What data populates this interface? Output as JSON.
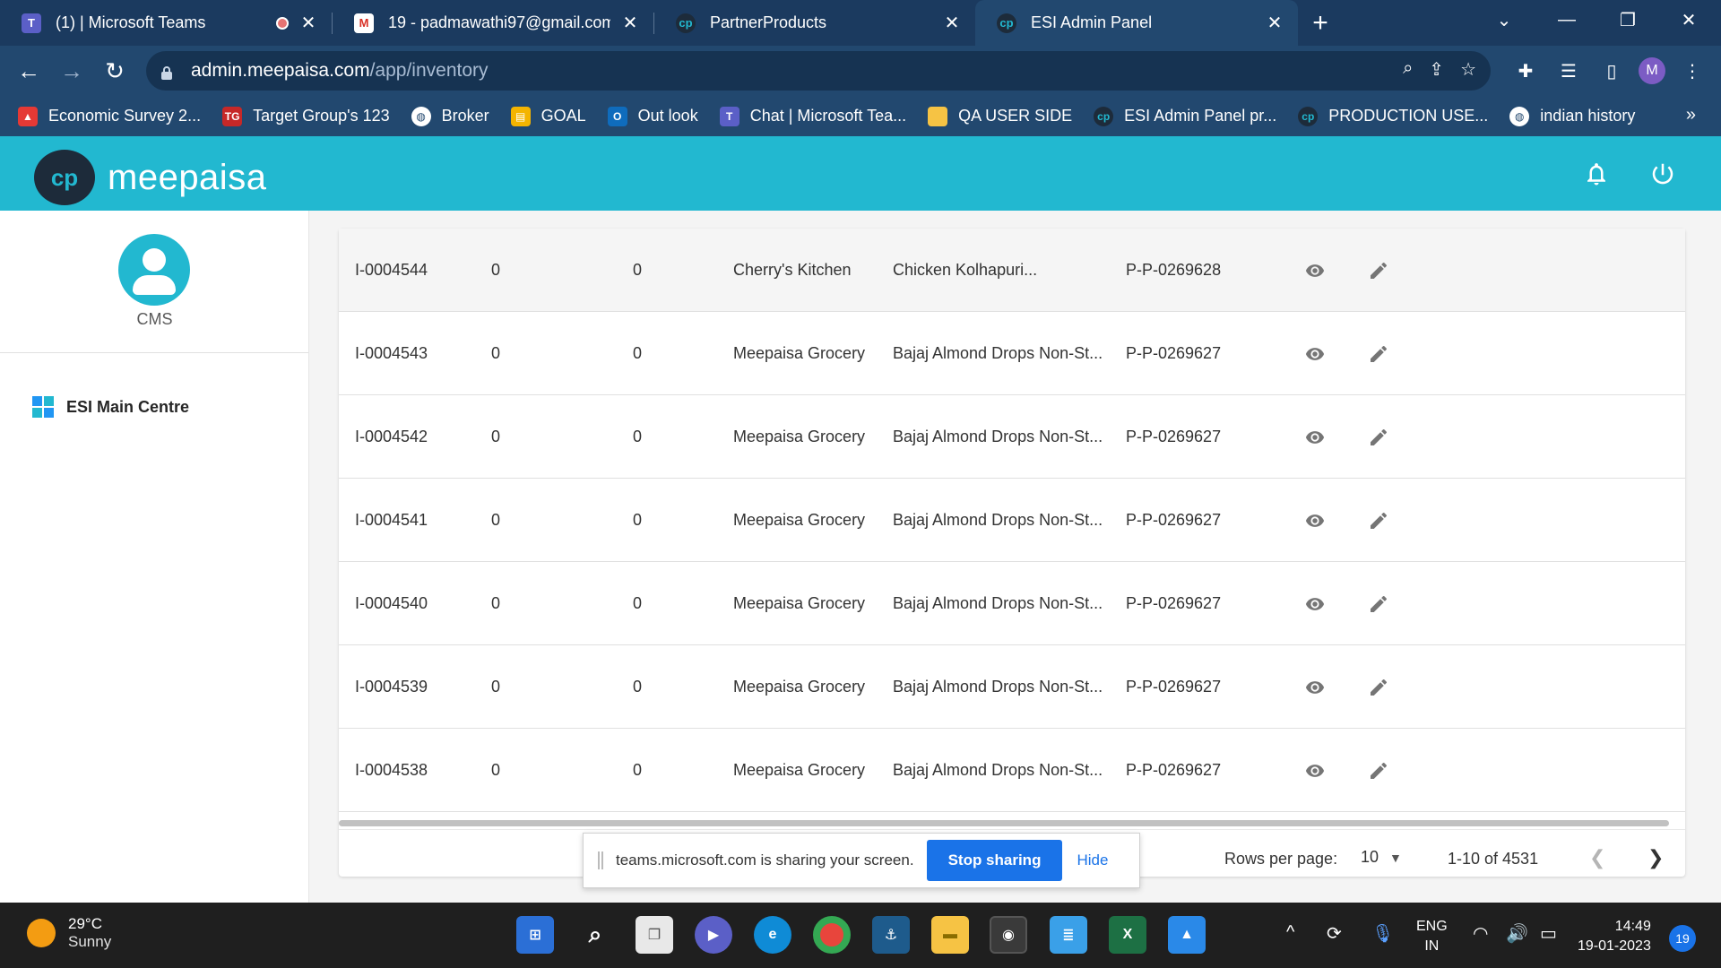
{
  "browser": {
    "tabs": [
      {
        "title": "(1) | Microsoft Teams",
        "icon": "teams-icon"
      },
      {
        "title": "19 - padmawathi97@gmail.com",
        "icon": "gmail-icon"
      },
      {
        "title": "PartnerProducts",
        "icon": "meepaisa-icon"
      },
      {
        "title": "ESI Admin Panel",
        "icon": "meepaisa-icon"
      }
    ],
    "url_host": "admin.meepaisa.com",
    "url_path": "/app/inventory",
    "profile_initial": "M",
    "bookmarks": [
      {
        "label": "Economic Survey 2...",
        "color": "#e53935"
      },
      {
        "label": "Target Group's 123",
        "color": "#c62828"
      },
      {
        "label": "Broker",
        "color": "#ffffff"
      },
      {
        "label": "GOAL",
        "color": "#f4b400"
      },
      {
        "label": "Out look",
        "color": "#0f6cbd"
      },
      {
        "label": "Chat | Microsoft Tea...",
        "color": "#5b5fc7"
      },
      {
        "label": "QA USER SIDE",
        "color": "#f6c344"
      },
      {
        "label": "ESI Admin Panel pr...",
        "color": "#1d2b3a"
      },
      {
        "label": "PRODUCTION USE...",
        "color": "#1d2b3a"
      },
      {
        "label": "indian history",
        "color": "#ffffff"
      }
    ],
    "bookmarks_more": "»"
  },
  "app": {
    "brand": "meepaisa",
    "accent": "#22b8d0"
  },
  "sidebar": {
    "user_label": "CMS",
    "items": [
      {
        "label": "ESI Main Centre",
        "icon": "dashboard-grid-icon"
      }
    ]
  },
  "table": {
    "rows": [
      {
        "id": "I-0004544",
        "c2": "0",
        "c3": "0",
        "partner": "Cherry's Kitchen",
        "product": "Chicken Kolhapuri...",
        "pid": "P-P-0269628"
      },
      {
        "id": "I-0004543",
        "c2": "0",
        "c3": "0",
        "partner": "Meepaisa Grocery",
        "product": "Bajaj Almond Drops Non-St...",
        "pid": "P-P-0269627"
      },
      {
        "id": "I-0004542",
        "c2": "0",
        "c3": "0",
        "partner": "Meepaisa Grocery",
        "product": "Bajaj Almond Drops Non-St...",
        "pid": "P-P-0269627"
      },
      {
        "id": "I-0004541",
        "c2": "0",
        "c3": "0",
        "partner": "Meepaisa Grocery",
        "product": "Bajaj Almond Drops Non-St...",
        "pid": "P-P-0269627"
      },
      {
        "id": "I-0004540",
        "c2": "0",
        "c3": "0",
        "partner": "Meepaisa Grocery",
        "product": "Bajaj Almond Drops Non-St...",
        "pid": "P-P-0269627"
      },
      {
        "id": "I-0004539",
        "c2": "0",
        "c3": "0",
        "partner": "Meepaisa Grocery",
        "product": "Bajaj Almond Drops Non-St...",
        "pid": "P-P-0269627"
      },
      {
        "id": "I-0004538",
        "c2": "0",
        "c3": "0",
        "partner": "Meepaisa Grocery",
        "product": "Bajaj Almond Drops Non-St...",
        "pid": "P-P-0269627"
      }
    ],
    "rows_per_page_label": "Rows per page:",
    "rows_per_page_value": "10",
    "range_label": "1-10 of 4531"
  },
  "share_banner": {
    "text": "teams.microsoft.com is sharing your screen.",
    "stop_label": "Stop sharing",
    "hide_label": "Hide"
  },
  "taskbar": {
    "temp": "29°C",
    "condition": "Sunny",
    "lang_line1": "ENG",
    "lang_line2": "IN",
    "time": "14:49",
    "date": "19-01-2023",
    "notif_count": "19"
  }
}
